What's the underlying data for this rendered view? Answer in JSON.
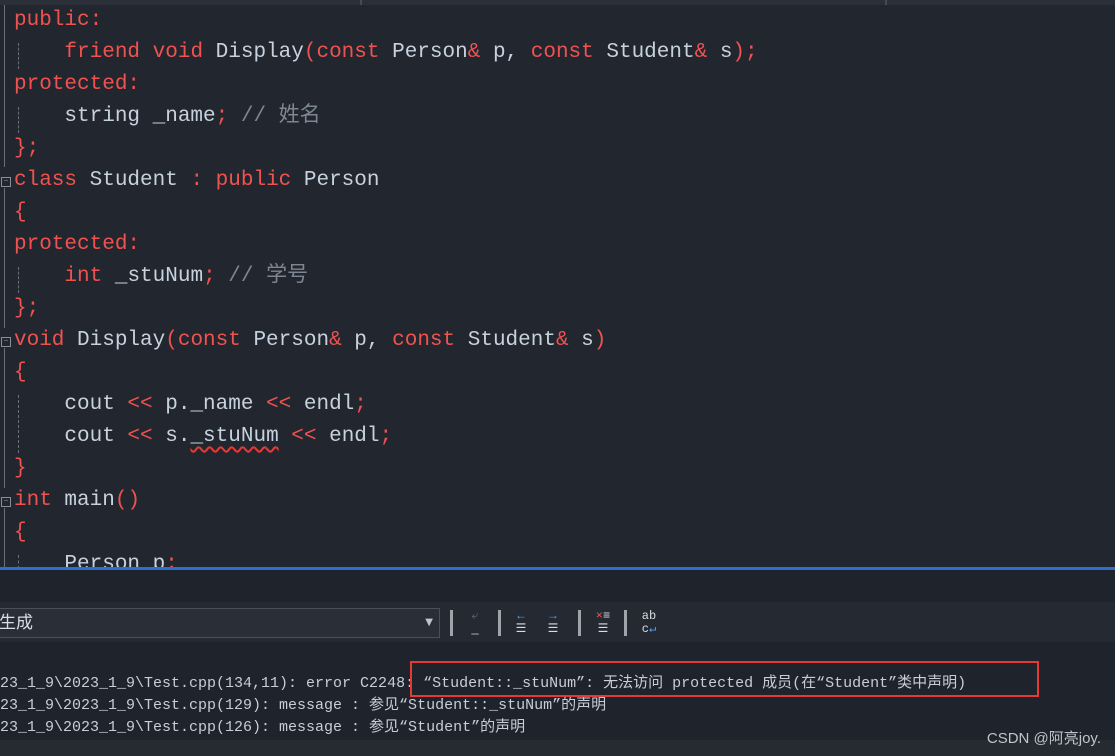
{
  "editor": {
    "lines": [
      [
        [
          "k",
          "public:"
        ]
      ],
      [
        [
          "i",
          "    "
        ],
        [
          "k",
          "friend void "
        ],
        [
          "i",
          "Display"
        ],
        [
          "k",
          "(const "
        ],
        [
          "i",
          "Person"
        ],
        [
          "k",
          "& "
        ],
        [
          "i",
          "p, "
        ],
        [
          "k",
          "const "
        ],
        [
          "i",
          "Student"
        ],
        [
          "k",
          "& "
        ],
        [
          "i",
          "s"
        ],
        [
          "k",
          ");"
        ]
      ],
      [
        [
          "k",
          "protected:"
        ]
      ],
      [
        [
          "i",
          "    string _name"
        ],
        [
          "k",
          "; "
        ],
        [
          "c",
          "// 姓名"
        ]
      ],
      [
        [
          "k",
          "};"
        ]
      ],
      [
        [
          "k",
          "class "
        ],
        [
          "i",
          "Student "
        ],
        [
          "k",
          ": public "
        ],
        [
          "i",
          "Person"
        ]
      ],
      [
        [
          "k",
          "{"
        ]
      ],
      [
        [
          "k",
          "protected:"
        ]
      ],
      [
        [
          "i",
          "    "
        ],
        [
          "k",
          "int "
        ],
        [
          "i",
          "_stuNum"
        ],
        [
          "k",
          "; "
        ],
        [
          "c",
          "// 学号"
        ]
      ],
      [
        [
          "k",
          "};"
        ]
      ],
      [
        [
          "k",
          "void "
        ],
        [
          "i",
          "Display"
        ],
        [
          "k",
          "(const "
        ],
        [
          "i",
          "Person"
        ],
        [
          "k",
          "& "
        ],
        [
          "i",
          "p, "
        ],
        [
          "k",
          "const "
        ],
        [
          "i",
          "Student"
        ],
        [
          "k",
          "& "
        ],
        [
          "i",
          "s"
        ],
        [
          "k",
          ")"
        ]
      ],
      [
        [
          "k",
          "{"
        ]
      ],
      [
        [
          "i",
          "    cout "
        ],
        [
          "k",
          "<< "
        ],
        [
          "i",
          "p._name "
        ],
        [
          "k",
          "<< "
        ],
        [
          "i",
          "endl"
        ],
        [
          "k",
          ";"
        ]
      ],
      [
        [
          "i",
          "    cout "
        ],
        [
          "k",
          "<< "
        ],
        [
          "i",
          "s."
        ],
        [
          "sq",
          "_stuNum"
        ],
        [
          "i",
          " "
        ],
        [
          "k",
          "<< "
        ],
        [
          "i",
          "endl"
        ],
        [
          "k",
          ";"
        ]
      ],
      [
        [
          "k",
          "}"
        ]
      ],
      [
        [
          "k",
          "int "
        ],
        [
          "i",
          "main"
        ],
        [
          "k",
          "()"
        ]
      ],
      [
        [
          "k",
          "{"
        ]
      ],
      [
        [
          "i",
          "    Person p"
        ],
        [
          "k",
          ";"
        ]
      ]
    ]
  },
  "output": {
    "source_label": "生成",
    "toolbar_icons": [
      "go-to-source-icon",
      "previous-message-icon",
      "next-message-icon",
      "clear-all-icon",
      "word-wrap-icon"
    ],
    "lines": [
      "23_1_9\\2023_1_9\\Test.cpp(134,11): error C2248: “Student::_stuNum”: 无法访问 protected 成员(在“Student”类中声明)",
      "23_1_9\\2023_1_9\\Test.cpp(129): message : 参见“Student::_stuNum”的声明",
      "23_1_9\\2023_1_9\\Test.cpp(126): message : 参见“Student”的声明"
    ]
  },
  "watermark": "CSDN @阿亮joy.",
  "colors": {
    "keyword": "#ef5350",
    "identifier": "#c6d2de",
    "comment": "#7d8793",
    "error_highlight": "#e53935",
    "divider": "#2d6fd0"
  }
}
